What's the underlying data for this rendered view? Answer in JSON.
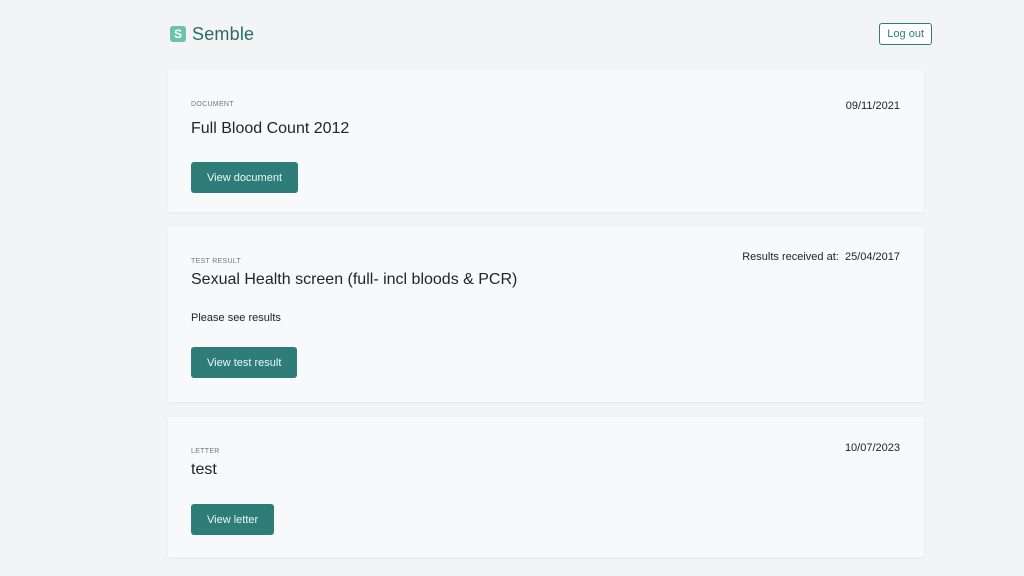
{
  "header": {
    "brand_mark": "S",
    "brand_name": "Semble",
    "logout_label": "Log out"
  },
  "items": [
    {
      "type_label": "Document",
      "date": "09/11/2021",
      "title": "Full Blood Count 2012",
      "action_label": "View document"
    },
    {
      "type_label": "Test result",
      "date": "Results received at:  25/04/2017",
      "title": "Sexual Health screen (full- incl bloods & PCR)",
      "note": "Please see results",
      "action_label": "View test result"
    },
    {
      "type_label": "Letter",
      "date": "10/07/2023",
      "title": "test",
      "action_label": "View letter"
    }
  ],
  "colors": {
    "accent": "#2f7d79",
    "logo": "#6cc3a9",
    "background": "#f3f4f5",
    "card": "#f8f9fa"
  }
}
